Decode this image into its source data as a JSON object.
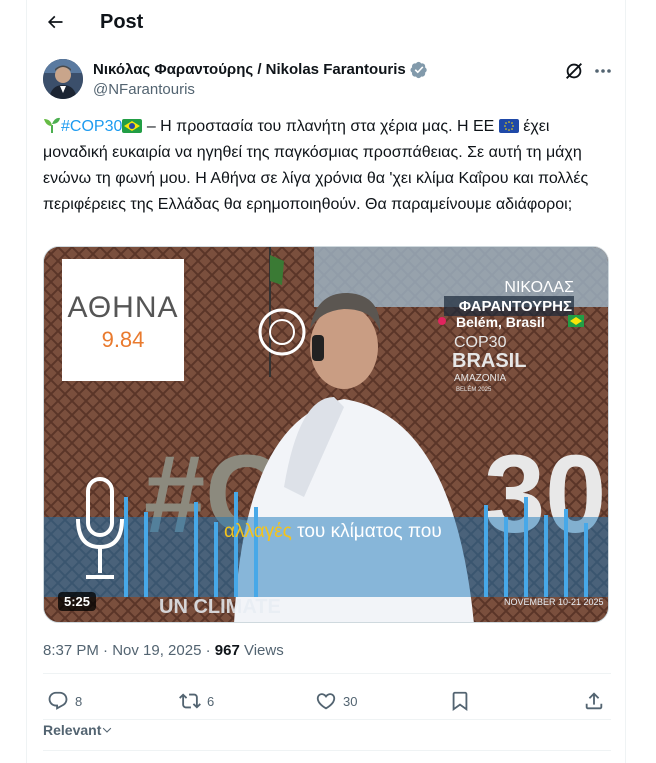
{
  "header": {
    "title": "Post"
  },
  "author": {
    "display_name": "Νικόλας Φαραντούρης / Nikolas Farantouris",
    "handle": "@NFarantouris"
  },
  "tweet": {
    "hashtag": "#COP30",
    "text_part1": " – Η προστασία του πλανήτη στα χέρια μας. Η ΕΕ ",
    "text_part2": " έχει μοναδική ευκαιρία να ηγηθεί της παγκόσμιας προσπάθειας. Σε αυτή τη μάχη ενώνω τη φωνή μου. Η Αθήνα σε λίγα χρόνια θα 'χει κλίμα Καΐρου και πολλές περιφέρειες της Ελλάδας θα ερημοποιηθούν. Θα παραμείνουμε αδιάφοροι;"
  },
  "video": {
    "logo_text": "ΑΘΗΝΑ",
    "logo_freq": "9.84",
    "overlay_name_line1": "ΝΙΚΟΛΑΣ",
    "overlay_name_line2": "ΦΑΡΑΝΤΟΥΡΗΣ",
    "overlay_location": "Belém, Brasil",
    "banner_line1": "COP30",
    "banner_line2": "BRASIL",
    "banner_line3": "AMAZONIA",
    "banner_line4": "BELÉM 2025",
    "big_hashtag": "#C",
    "big_number": "30",
    "subtitle_highlight": "αλλαγές",
    "subtitle_rest": " του κλίματος που",
    "un_climate": "UN CLIMATE",
    "dates": "NOVEMBER 10-21 2025",
    "duration": "5:25"
  },
  "meta": {
    "time": "8:37 PM · Nov 19, 2025 · ",
    "views_count": "967",
    "views_label": " Views"
  },
  "actions": {
    "replies": "8",
    "reposts": "6",
    "likes": "30"
  },
  "sort": {
    "label": "Relevant"
  },
  "colors": {
    "accent": "#1d9bf0",
    "muted": "#536471",
    "text": "#0f1419"
  }
}
